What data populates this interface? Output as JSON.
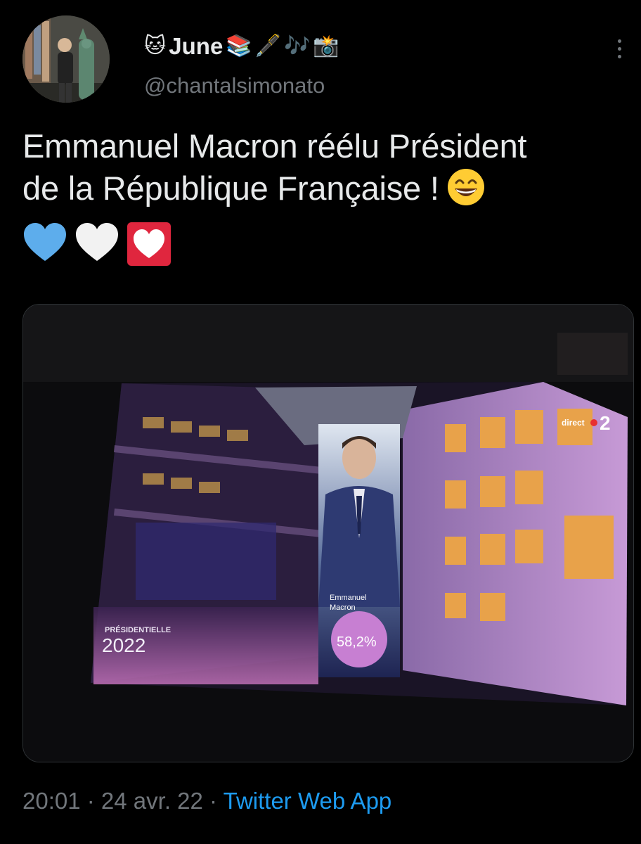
{
  "user": {
    "display_name": "June",
    "name_emojis": [
      "🐱",
      "📚",
      "🖋️",
      "🎶",
      "📸"
    ],
    "handle": "@chantalsimonato"
  },
  "tweet": {
    "text_line1": "Emmanuel Macron réélu Président",
    "text_line2": "de la République Française !",
    "trailing_emoji": "grinning-face",
    "hearts": [
      "blue-heart",
      "white-heart",
      "heart-decoration"
    ]
  },
  "media": {
    "channel_label": "direct",
    "channel_number": "2",
    "event_label": "PRÉSIDENTIELLE",
    "event_year": "2022",
    "candidate_first": "Emmanuel",
    "candidate_last": "Macron",
    "result": "58,2%"
  },
  "meta": {
    "time": "20:01",
    "sep1": " · ",
    "date": "24 avr. 22",
    "sep2": " · ",
    "source": "Twitter Web App"
  },
  "colors": {
    "background": "#000000",
    "text": "#e7e9ea",
    "secondary": "#71767b",
    "link": "#1d9bf0"
  }
}
